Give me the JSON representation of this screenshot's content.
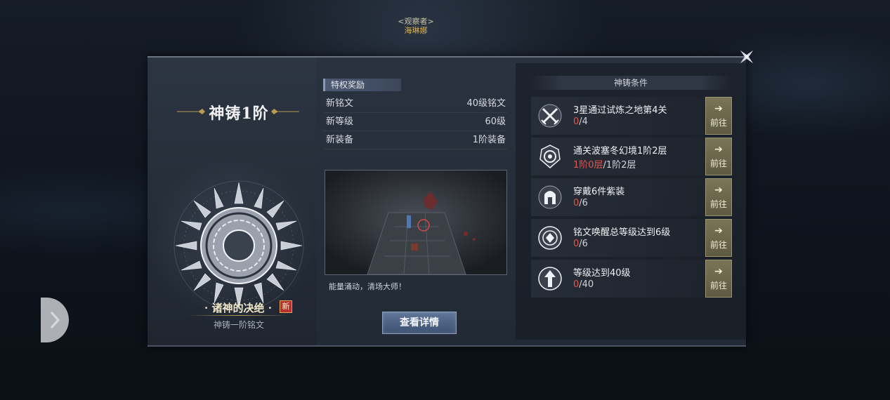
{
  "observer": {
    "role": "<观察者>",
    "name": "海琳娜"
  },
  "tier": {
    "title": "神铸1阶"
  },
  "rune": {
    "name": "· 诸神的决绝 ·",
    "new_badge": "新",
    "subtitle": "神铸一阶铭文"
  },
  "rewards": {
    "header": "特权奖励",
    "rows": [
      {
        "key": "新铭文",
        "value": "40级铭文"
      },
      {
        "key": "新等级",
        "value": "60级"
      },
      {
        "key": "新装备",
        "value": "1阶装备"
      }
    ],
    "preview_caption": "能量涌动，清场大师！",
    "detail_button": "查看详情"
  },
  "conditions": {
    "header": "神铸条件",
    "items": [
      {
        "icon": "crossed-swords-icon",
        "title": "3星通过试炼之地第4关",
        "progress_red": "0",
        "progress_rest": "/4",
        "go_label": "前往"
      },
      {
        "icon": "spiral-crest-icon",
        "title": "通关波塞冬幻境1阶2层",
        "progress_red": "1阶0层",
        "progress_rest": "/1阶2层",
        "go_label": "前往"
      },
      {
        "icon": "helmet-icon",
        "title": "穿戴6件紫装",
        "progress_red": "0",
        "progress_rest": "/6",
        "go_label": "前往"
      },
      {
        "icon": "rune-eye-icon",
        "title": "铭文唤醒总等级达到6级",
        "progress_red": "0",
        "progress_rest": "/6",
        "go_label": "前往"
      },
      {
        "icon": "level-arrow-icon",
        "title": "等级达到40级",
        "progress_red": "0",
        "progress_rest": "/40",
        "go_label": "前往"
      }
    ]
  },
  "colors": {
    "progress_red": "#e5534b",
    "go_button": "#7a7557",
    "detail_button": "#4d6386"
  }
}
